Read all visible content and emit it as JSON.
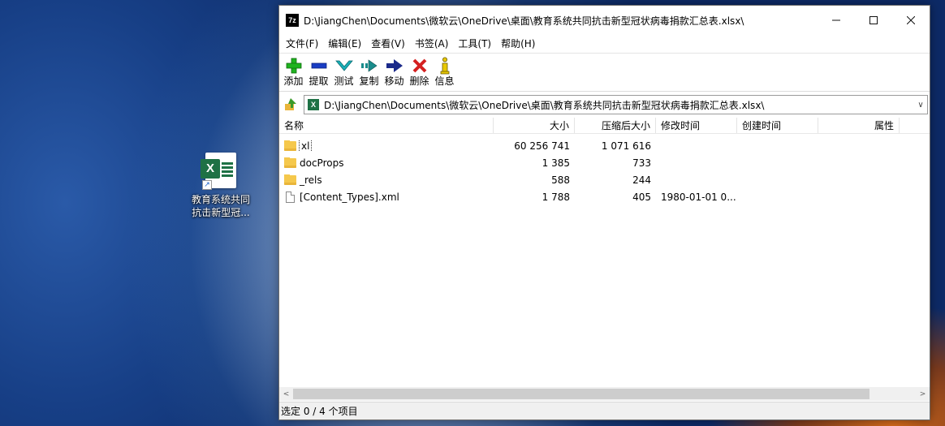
{
  "desktop": {
    "icon_label": "教育系统共同抗击新型冠..."
  },
  "window": {
    "app_icon_text": "7z",
    "title": "D:\\JiangChen\\Documents\\微软云\\OneDrive\\桌面\\教育系统共同抗击新型冠状病毒捐款汇总表.xlsx\\"
  },
  "menu": [
    "文件(F)",
    "编辑(E)",
    "查看(V)",
    "书签(A)",
    "工具(T)",
    "帮助(H)"
  ],
  "toolbar": {
    "add": "添加",
    "extract": "提取",
    "test": "测试",
    "copy": "复制",
    "move": "移动",
    "delete": "删除",
    "info": "信息"
  },
  "address": {
    "path": "D:\\JiangChen\\Documents\\微软云\\OneDrive\\桌面\\教育系统共同抗击新型冠状病毒捐款汇总表.xlsx\\"
  },
  "columns": {
    "name": "名称",
    "size": "大小",
    "packed": "压缩后大小",
    "modified": "修改时间",
    "created": "创建时间",
    "attributes": "属性"
  },
  "files": [
    {
      "name": "xl",
      "size": "60 256 741",
      "packed": "1 071 616",
      "modified": "",
      "type": "folder"
    },
    {
      "name": "docProps",
      "size": "1 385",
      "packed": "733",
      "modified": "",
      "type": "folder"
    },
    {
      "name": "_rels",
      "size": "588",
      "packed": "244",
      "modified": "",
      "type": "folder"
    },
    {
      "name": "[Content_Types].xml",
      "size": "1 788",
      "packed": "405",
      "modified": "1980-01-01 0...",
      "type": "file"
    }
  ],
  "status": "选定 0 / 4 个项目",
  "colors": {
    "add": "#1fb31f",
    "extract": "#1a3dc4",
    "test": "#19b0b8",
    "copy": "#1a8c8c",
    "move": "#1b2a8a",
    "delete": "#d42020",
    "info": "#e8c800"
  }
}
